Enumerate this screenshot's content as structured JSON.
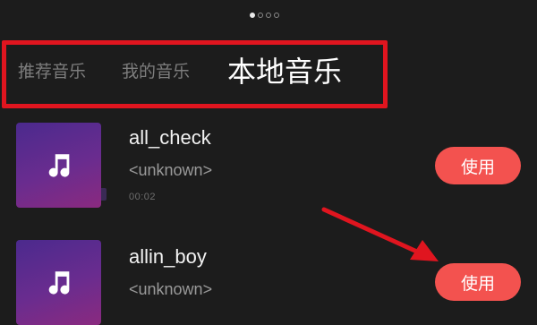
{
  "pager": {
    "count": 4,
    "active_index": 0
  },
  "tabs": [
    {
      "label": "推荐音乐",
      "active": false
    },
    {
      "label": "我的音乐",
      "active": false
    },
    {
      "label": "本地音乐",
      "active": true
    }
  ],
  "songs": [
    {
      "title": "all_check",
      "artist": "<unknown>",
      "duration": "00:02",
      "action_label": "使用",
      "cover_icon": "music-note-icon"
    },
    {
      "title": "allin_boy",
      "artist": "<unknown>",
      "duration": "",
      "action_label": "使用",
      "cover_icon": "music-note-icon"
    }
  ],
  "colors": {
    "background": "#1c1c1c",
    "highlight_box": "#e0151f",
    "accent_button": "#f3524f",
    "annotation_arrow": "#e0151f"
  }
}
